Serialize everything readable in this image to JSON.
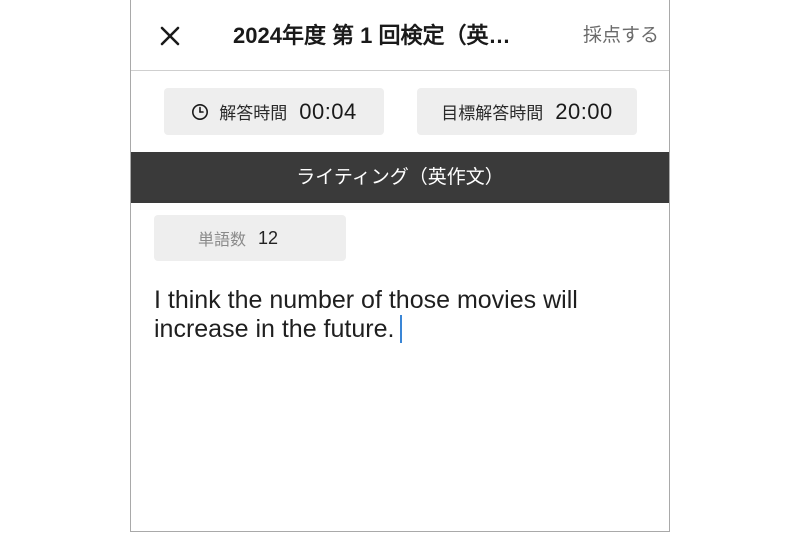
{
  "header": {
    "close_icon": "close-icon",
    "title": "2024年度 第 1 回検定（英…",
    "submit_label": "採点する"
  },
  "timers": {
    "elapsed": {
      "icon": "clock-icon",
      "label": "解答時間",
      "value": "00:04"
    },
    "target": {
      "label": "目標解答時間",
      "value": "20:00"
    }
  },
  "section": {
    "title": "ライティング（英作文）"
  },
  "word_count": {
    "label": "単語数",
    "value": "12"
  },
  "answer": {
    "text": "I think the number of those movies will increase in the future."
  },
  "colors": {
    "section_bar": "#3a3a3a",
    "caret": "#3a86d6",
    "chip_background": "#eeeeee"
  }
}
